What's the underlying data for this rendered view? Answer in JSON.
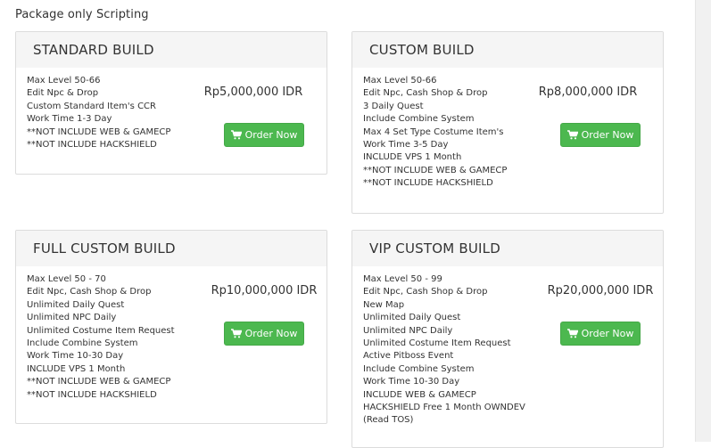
{
  "page": {
    "title": "Package only Scripting"
  },
  "cards": [
    {
      "title": "STANDARD BUILD",
      "price": "Rp5,000,000 IDR",
      "button": "Order Now",
      "features": [
        "Max Level 50-66",
        "Edit Npc & Drop",
        "Custom Standard Item's CCR",
        "Work Time 1-3 Day",
        "**NOT INCLUDE WEB & GAMECP",
        "**NOT INCLUDE HACKSHIELD"
      ]
    },
    {
      "title": "CUSTOM BUILD",
      "price": "Rp8,000,000 IDR",
      "button": "Order Now",
      "features": [
        "Max Level 50-66",
        "Edit Npc, Cash Shop & Drop",
        "3 Daily Quest",
        "Include Combine System",
        "Max 4 Set Type Costume Item's",
        "Work Time 3-5 Day",
        "INCLUDE VPS 1 Month",
        "**NOT INCLUDE WEB & GAMECP",
        "**NOT INCLUDE HACKSHIELD"
      ]
    },
    {
      "title": "FULL CUSTOM BUILD",
      "price": "Rp10,000,000 IDR",
      "button": "Order Now",
      "features": [
        "Max Level 50 - 70",
        "Edit Npc, Cash Shop & Drop",
        "Unlimited Daily Quest",
        "Unlimited NPC Daily",
        "Unlimited Costume Item Request",
        "Include Combine System",
        "Work Time 10-30 Day",
        "INCLUDE VPS 1 Month",
        "**NOT INCLUDE WEB & GAMECP",
        "**NOT INCLUDE HACKSHIELD"
      ]
    },
    {
      "title": "VIP CUSTOM BUILD",
      "price": "Rp20,000,000 IDR",
      "button": "Order Now",
      "features": [
        "Max Level 50 - 99",
        "Edit Npc, Cash Shop & Drop",
        "New Map",
        "Unlimited Daily Quest",
        "Unlimited NPC Daily",
        "Unlimited Costume Item Request",
        "Active Pitboss Event",
        "Include Combine System",
        "Work Time 10-30 Day",
        "INCLUDE WEB & GAMECP",
        "HACKSHIELD Free 1 Month OWNDEV",
        "(Read TOS)"
      ]
    }
  ],
  "icons": {
    "order": "shopping-cart-icon"
  },
  "colors": {
    "button": "#4cb84f",
    "header_bg": "#f5f5f5",
    "border": "#dcdcdc"
  }
}
